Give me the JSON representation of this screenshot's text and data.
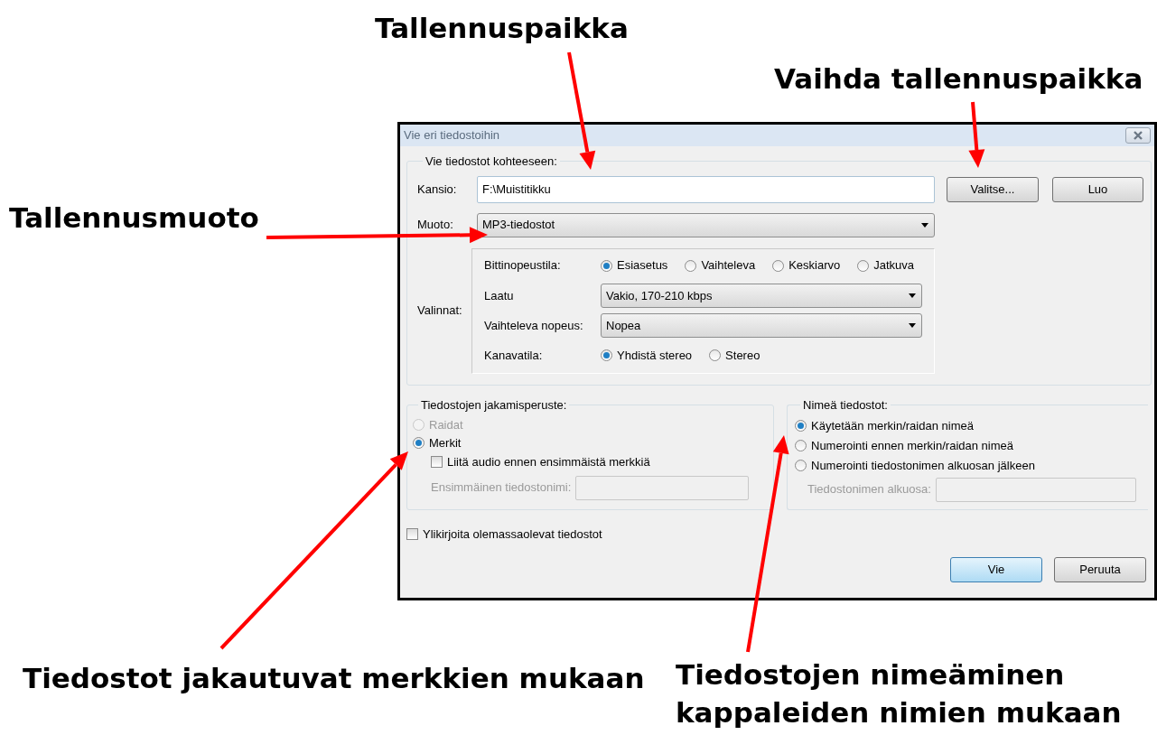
{
  "annotations": [
    {
      "text": "Tallennuspaikka"
    },
    {
      "text": "Vaihda tallennuspaikka"
    },
    {
      "text": "Tallennusmuoto"
    },
    {
      "text": "Tiedostot jakautuvat merkkien mukaan"
    },
    {
      "text": "Tiedostojen nimeäminen kappaleiden nimien mukaan"
    }
  ],
  "dialog": {
    "title": "Vie eri tiedostoihin",
    "destination": {
      "legend": "Vie tiedostot kohteeseen:",
      "folder_label": "Kansio:",
      "folder_value": "F:\\Muistitikku",
      "choose_button": "Valitse...",
      "create_button": "Luo",
      "format_label": "Muoto:",
      "format_value": "MP3-tiedostot",
      "options_label": "Valinnat:",
      "options": [
        {
          "kind": "radio",
          "label": "Bittinopeustila:",
          "choices": [
            {
              "label": "Esiasetus",
              "selected": true
            },
            {
              "label": "Vaihteleva",
              "selected": false
            },
            {
              "label": "Keskiarvo",
              "selected": false
            },
            {
              "label": "Jatkuva",
              "selected": false
            }
          ]
        },
        {
          "kind": "select",
          "label": "Laatu",
          "value": "Vakio, 170-210 kbps"
        },
        {
          "kind": "select",
          "label": "Vaihteleva nopeus:",
          "value": "Nopea"
        },
        {
          "kind": "radio",
          "label": "Kanavatila:",
          "choices": [
            {
              "label": "Yhdistä stereo",
              "selected": true
            },
            {
              "label": "Stereo",
              "selected": false
            }
          ]
        }
      ]
    },
    "split": {
      "legend": "Tiedostojen jakamisperuste:",
      "choices": [
        {
          "label": "Raidat",
          "selected": false,
          "disabled": true
        },
        {
          "label": "Merkit",
          "selected": true,
          "disabled": false
        }
      ],
      "include_audio": {
        "label": "Liitä audio ennen ensimmäistä merkkiä",
        "checked": false
      },
      "first_name": {
        "label": "Ensimmäinen tiedostonimi:",
        "disabled": true
      }
    },
    "naming": {
      "legend": "Nimeä tiedostot:",
      "choices": [
        {
          "label": "Käytetään merkin/raidan nimeä",
          "selected": true
        },
        {
          "label": "Numerointi ennen merkin/raidan nimeä",
          "selected": false
        },
        {
          "label": "Numerointi tiedostonimen alkuosan jälkeen",
          "selected": false
        }
      ],
      "prefix": {
        "label": "Tiedostonimen alkuosa:",
        "disabled": true
      }
    },
    "overwrite": {
      "label": "Ylikirjoita olemassaolevat tiedostot",
      "checked": false
    },
    "buttons": [
      {
        "label": "Vie",
        "default": true
      },
      {
        "label": "Peruuta",
        "default": false
      }
    ]
  }
}
